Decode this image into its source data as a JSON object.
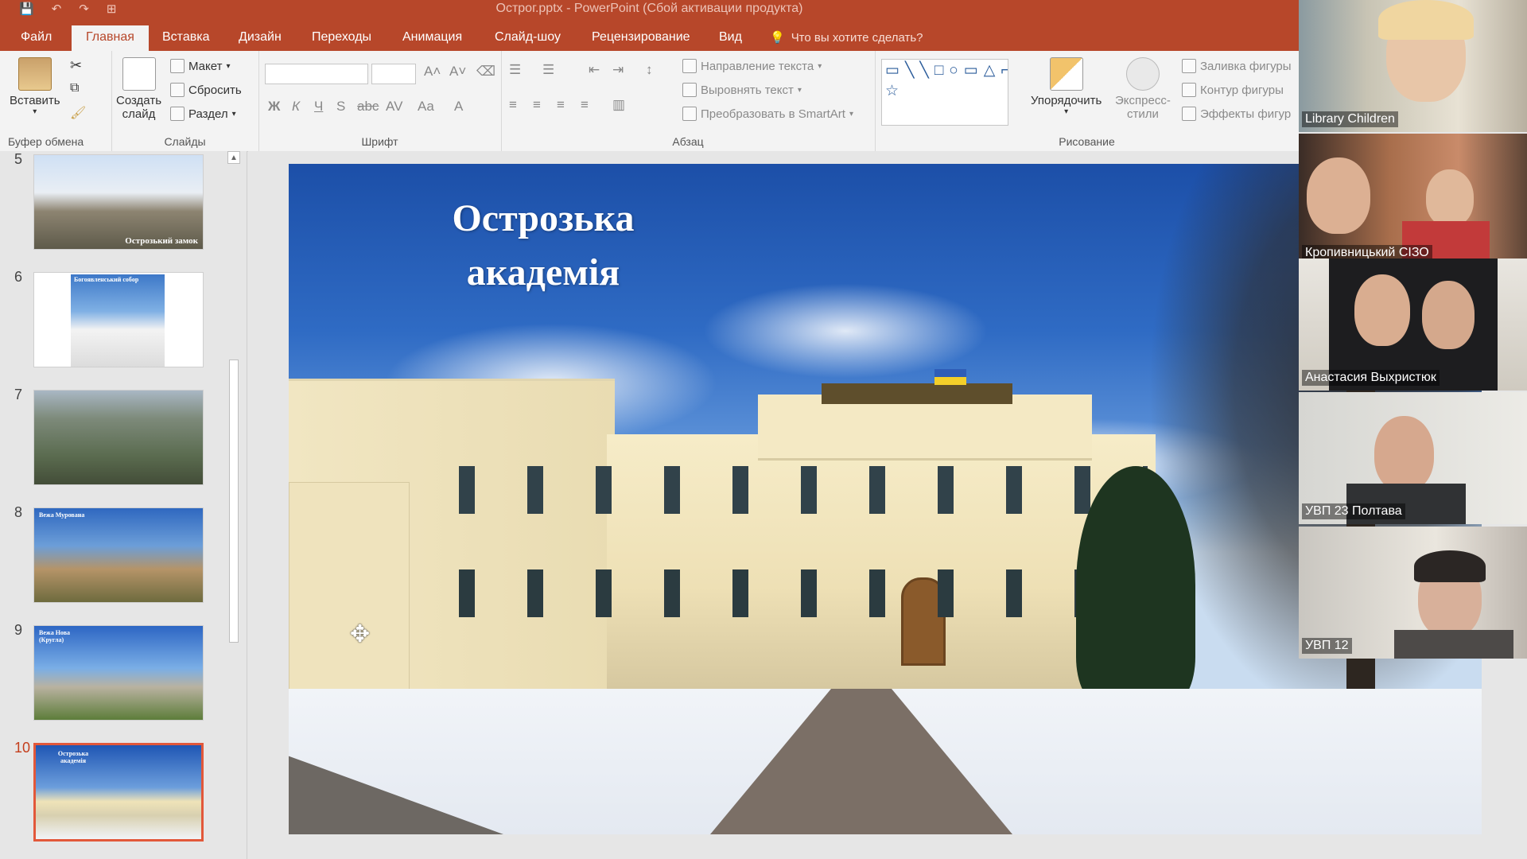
{
  "window": {
    "title": "Острог.pptx - PowerPoint (Сбой активации продукта)",
    "qat": [
      "💾",
      "↶",
      "↷",
      "⊞"
    ]
  },
  "tabs": [
    "Файл",
    "Главная",
    "Вставка",
    "Дизайн",
    "Переходы",
    "Анимация",
    "Слайд-шоу",
    "Рецензирование",
    "Вид"
  ],
  "tell_me": "Что вы хотите сделать?",
  "ribbon": {
    "clipboard": {
      "paste": "Вставить",
      "group": "Буфер обмена"
    },
    "slides": {
      "new_slide_1": "Создать",
      "new_slide_2": "слайд",
      "layout": "Макет",
      "reset": "Сбросить",
      "section": "Раздел",
      "group": "Слайды"
    },
    "font": {
      "group": "Шрифт",
      "buttons": [
        "Ж",
        "К",
        "Ч",
        "S",
        "abc",
        "AV",
        "Aa",
        "A"
      ]
    },
    "paragraph": {
      "group": "Абзац",
      "text_direction": "Направление текста",
      "align_text": "Выровнять текст",
      "smartart": "Преобразовать в SmartArt"
    },
    "drawing": {
      "group": "Рисование",
      "arrange": "Упорядочить",
      "quick_styles_1": "Экспресс-",
      "quick_styles_2": "стили",
      "shape_fill": "Заливка фигуры",
      "shape_outline": "Контур фигуры",
      "shape_effects": "Эффекты фигур"
    }
  },
  "thumbnails": [
    {
      "num": "5",
      "caption": "Острозький замок"
    },
    {
      "num": "6",
      "caption": "Богоявленський собор"
    },
    {
      "num": "7",
      "caption": ""
    },
    {
      "num": "8",
      "caption": "Вежа Мурована"
    },
    {
      "num": "9",
      "caption": "Вежа Нова (Кругла)"
    },
    {
      "num": "10",
      "caption": "Острозька академія"
    }
  ],
  "slide": {
    "title_line1": "Острозька",
    "title_line2": "академія"
  },
  "participants": [
    "Library Children",
    "Кропивницький СІЗО",
    "Анастасия Выхристюк",
    "УВП 23 Полтава",
    "УВП 12"
  ],
  "colors": {
    "accent": "#b7472a",
    "active_thumb": "#e2583a"
  }
}
